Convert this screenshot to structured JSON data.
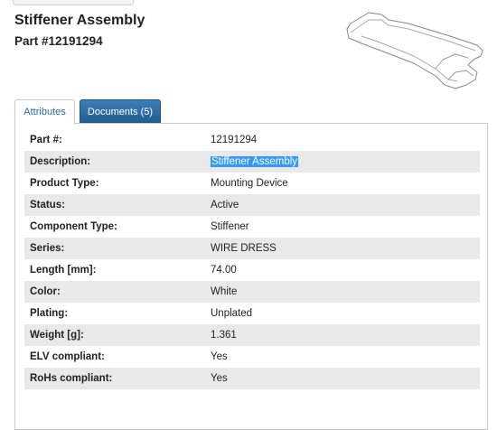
{
  "product": {
    "title": "Stiffener Assembly",
    "part_number_heading": "Part #12191294"
  },
  "tabs": [
    {
      "label": "Attributes",
      "active": true
    },
    {
      "label": "Documents (5)",
      "active": false
    }
  ],
  "attributes": [
    {
      "label": "Part #:",
      "value": "12191294"
    },
    {
      "label": "Description:",
      "value": "Stiffener Assembly",
      "selected": true
    },
    {
      "label": "Product Type:",
      "value": "Mounting Device"
    },
    {
      "label": "Status:",
      "value": "Active"
    },
    {
      "label": "Component Type:",
      "value": "Stiffener"
    },
    {
      "label": "Series:",
      "value": "WIRE DRESS"
    },
    {
      "label": "Length [mm]:",
      "value": "74.00"
    },
    {
      "label": "Color:",
      "value": "White"
    },
    {
      "label": "Plating:",
      "value": "Unplated"
    },
    {
      "label": "Weight [g]:",
      "value": "1.361"
    },
    {
      "label": "ELV compliant:",
      "value": "Yes"
    },
    {
      "label": "RoHs compliant:",
      "value": "Yes"
    }
  ],
  "colors": {
    "accent_tab": "#2a6aa0",
    "selection": "#3399ff",
    "row_stripe": "#e9e9e9"
  },
  "icons": {
    "product_image": "stiffener-part-drawing"
  }
}
